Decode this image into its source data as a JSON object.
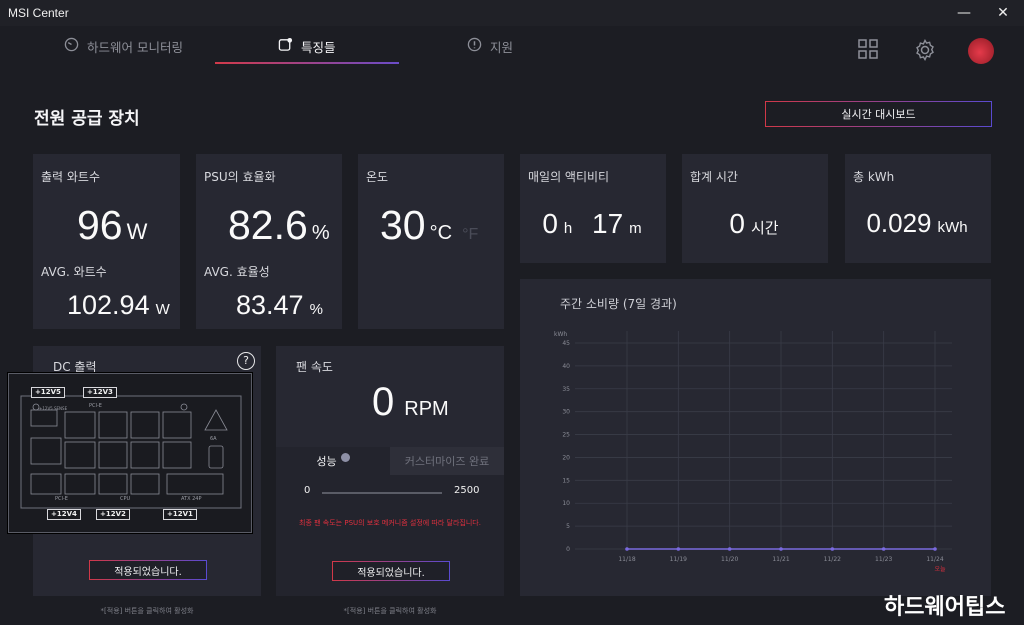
{
  "window": {
    "title": "MSI Center",
    "minimize_glyph": "—",
    "close_glyph": "✕"
  },
  "nav": {
    "tabs": [
      {
        "label": "하드웨어 모니터링",
        "icon": "gauge-icon"
      },
      {
        "label": "특징들",
        "icon": "features-icon"
      },
      {
        "label": "지원",
        "icon": "support-icon"
      }
    ],
    "active_tab": "특징들",
    "right_icons": [
      "grid-icon",
      "gear-icon",
      "dragon-avatar-icon"
    ]
  },
  "page": {
    "title": "전원 공급 장치",
    "dashboard_button": "실시간 대시보드"
  },
  "cards": {
    "output_watts": {
      "label": "출력 와트수",
      "value": "96",
      "unit": "W",
      "avg_label": "AVG. 와트수",
      "avg_value": "102.94",
      "avg_unit": "W"
    },
    "efficiency": {
      "label": "PSU의 효율화",
      "value": "82.6",
      "unit": "%",
      "avg_label": "AVG. 효율성",
      "avg_value": "83.47",
      "avg_unit": "%"
    },
    "temperature": {
      "label": "온도",
      "value": "30",
      "unit": "°C",
      "alt_unit": "°F"
    },
    "daily_activity": {
      "label": "매일의 액티비티",
      "hours": "0",
      "hours_unit": "h",
      "minutes": "17",
      "minutes_unit": "m"
    },
    "total_time": {
      "label": "합계 시간",
      "value": "0",
      "unit": "시간"
    },
    "total_kwh": {
      "label": "총 kWh",
      "value": "0.029",
      "unit": "kWh"
    }
  },
  "dc_output": {
    "label": "DC 출력",
    "help_glyph": "?",
    "apply_button": "적용되었습니다.",
    "hint": "*[적용] 버튼을 클릭하여 활성화",
    "diagram": {
      "rails_top": [
        "+12V5",
        "+12V3"
      ],
      "rails_bottom": [
        "+12V4",
        "+12V2",
        "+12V1"
      ],
      "section_labels": [
        "PCI-E",
        "PCI-E",
        "CPU",
        "ATX 24P"
      ],
      "small_labels": [
        "+12V5 SENSE",
        "6A"
      ]
    }
  },
  "fan": {
    "label": "팬 속도",
    "value": "0",
    "unit": "RPM",
    "tabs": [
      "성능",
      "커스터마이즈 완료"
    ],
    "active_tab": "성능",
    "slider": {
      "min": "0",
      "max": "2500",
      "level": 0.0
    },
    "warning": "최종 팬 속도는 PSU의 보호 메커니즘 설정에 따라 달라집니다.",
    "apply_button": "적용되었습니다.",
    "hint": "*[적용] 버튼을 클릭하여 활성화"
  },
  "weekly": {
    "title": "주간 소비량 (7일 경과)"
  },
  "chart_data": {
    "type": "line",
    "title": "주간 소비량 (7일 경과)",
    "ylabel": "kWh",
    "x": [
      "11/18",
      "11/19",
      "11/20",
      "11/21",
      "11/22",
      "11/23",
      "11/24"
    ],
    "today_label": "오늘",
    "series": [
      {
        "values": [
          0,
          0,
          0,
          0,
          0,
          0,
          0
        ]
      }
    ],
    "ylim": [
      0,
      45
    ],
    "yticks": [
      0,
      5,
      10,
      15,
      20,
      25,
      30,
      35,
      40,
      45
    ],
    "grid": true,
    "colors": {
      "line": "#7a6ae0",
      "grid": "#3a3c48"
    }
  },
  "watermark": "하드웨어팁스",
  "colors": {
    "accent_red": "#d23a4a",
    "accent_purple": "#6a4cc8",
    "warning": "#e0303e",
    "card_bg": "#272832"
  }
}
